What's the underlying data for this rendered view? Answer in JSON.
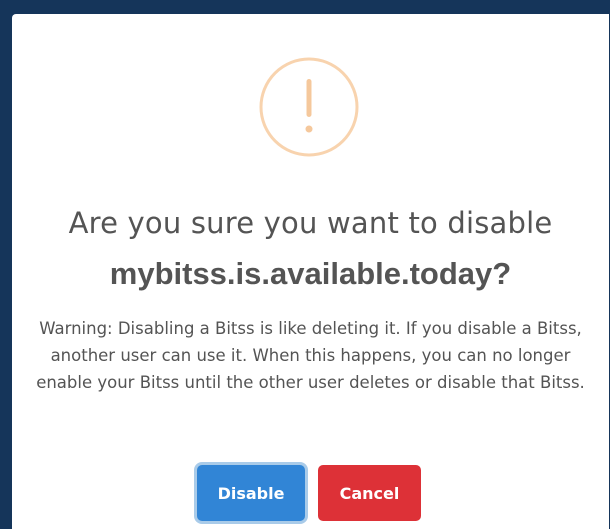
{
  "dialog": {
    "icon": "warning-icon",
    "icon_glyph": "!",
    "icon_color": "#f8bb86",
    "title": "Are you sure you want to disable",
    "domain": "mybitss.is.available.today?",
    "warning_text": "Warning: Disabling a Bitss is like deleting it. If you disable a Bitss, another user can use it. When this happens, you can no longer enable your Bitss until the other user deletes or disable that Bitss.",
    "confirm_label": "Disable",
    "cancel_label": "Cancel",
    "confirm_color": "#3185d6",
    "cancel_color": "#dd3137"
  },
  "backdrop_color": "#15355a"
}
